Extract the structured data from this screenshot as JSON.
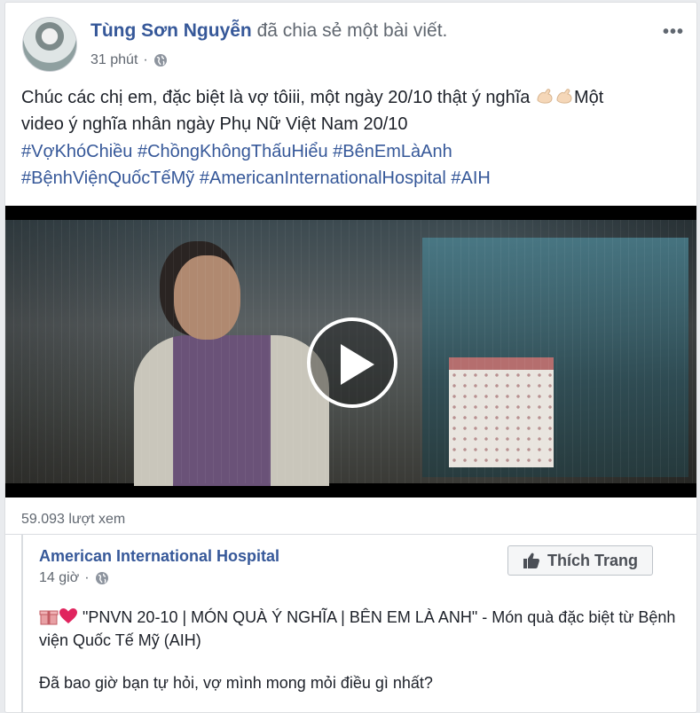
{
  "post": {
    "author": "Tùng Sơn Nguyễn",
    "action": "đã chia sẻ một bài viết.",
    "time": "31 phút",
    "more_label": "•••",
    "text_line1_a": "Chúc các chị em, đặc biệt là vợ tôiii, một ngày 20/10 thật ý nghĩa",
    "text_line1_b": "Một",
    "text_line2": "video ý nghĩa nhân ngày Phụ Nữ Việt Nam 20/10",
    "hashtags": [
      "#VợKhóChiều",
      "#ChồngKhôngThấuHiểu",
      "#BênEmLàAnh",
      "#BệnhViệnQuốcTếMỹ",
      "#AmericanInternationalHospital",
      "#AIH"
    ],
    "views": "59.093 lượt xem"
  },
  "shared": {
    "page_name": "American International Hospital",
    "time": "14 giờ",
    "like_button": "Thích Trang",
    "text1": "\"PNVN 20-10 | MÓN QUÀ Ý NGHĨA | BÊN EM LÀ ANH\" - Món quà đặc biệt từ Bệnh viện Quốc Tế Mỹ (AIH)",
    "text2": "Đã bao giờ bạn tự hỏi, vợ mình mong mỏi điều gì nhất?"
  },
  "colors": {
    "link": "#365899",
    "meta": "#606770",
    "background": "#e9ebee"
  }
}
